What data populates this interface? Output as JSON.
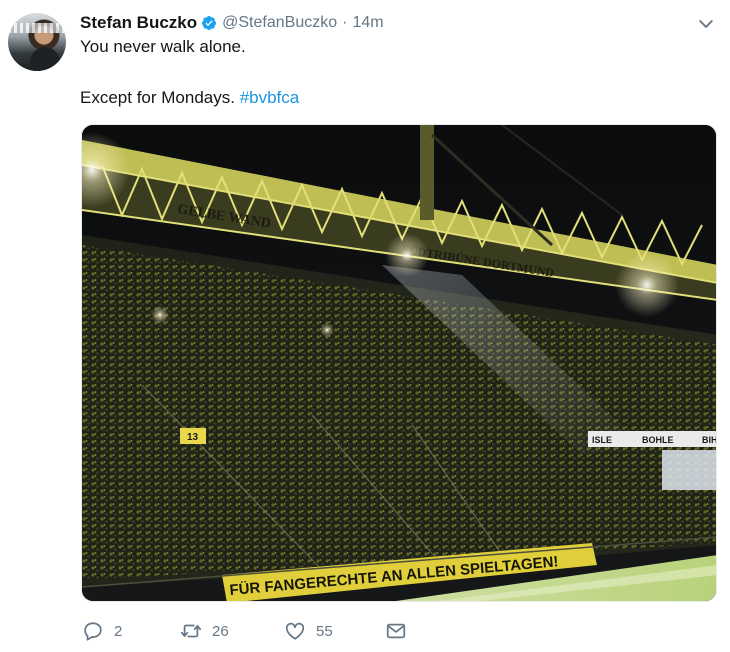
{
  "tweet": {
    "author_name": "Stefan Buczko",
    "handle": "@StefanBuczko",
    "separator": "·",
    "time": "14m",
    "verified": true,
    "text_line1": "You never walk alone.",
    "text_line2": "Except for Mondays. ",
    "hashtag": "#bvbfca",
    "media": {
      "roof_sign_1": "GELBE WAND",
      "roof_sign_2": "SÜDTRIBÜNE DORTMUND",
      "banner": "FÜR FANGERECHTE AN ALLEN SPIELTAGEN!",
      "sign_left": "ISLE",
      "sign_mid": "BOHLE",
      "sign_right": "BIH",
      "block_number": "13"
    },
    "actions": {
      "reply_count": "2",
      "retweet_count": "26",
      "like_count": "55"
    }
  },
  "colors": {
    "link": "#1b95e0",
    "muted": "#657786",
    "verified": "#1da1f2",
    "text": "#14171a"
  }
}
